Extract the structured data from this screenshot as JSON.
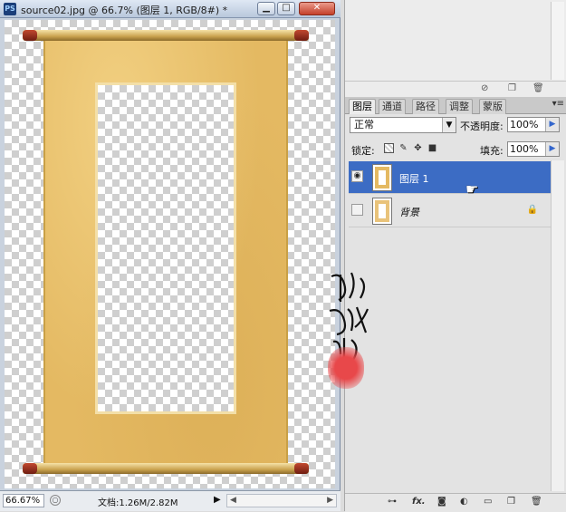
{
  "document_window": {
    "title": "source02.jpg @ 66.7% (图层 1, RGB/8#) *",
    "app_badge": "PS",
    "buttons": {
      "minimize": "▁",
      "maximize": "□",
      "close": "✕"
    },
    "status": {
      "zoom": "66.67%",
      "doc_info": "文档:1.26M/2.82M",
      "arrow": "▶"
    }
  },
  "layers_panel": {
    "tabs": [
      "图层",
      "通道",
      "路径",
      "调整",
      "蒙版"
    ],
    "active_tab": "图层",
    "menu_icon": "▾≡",
    "blend_mode": "正常",
    "opacity_label": "不透明度:",
    "opacity_value": "100%",
    "lock_label": "锁定:",
    "fill_label": "填充:",
    "fill_value": "100%",
    "layers": [
      {
        "name": "图层 1",
        "selected": true,
        "visible": true,
        "locked": false
      },
      {
        "name": "背景",
        "selected": false,
        "visible": false,
        "locked": true
      }
    ],
    "footer_icons": [
      "link-icon",
      "fx-icon",
      "mask-icon",
      "adjustment-icon",
      "group-icon",
      "new-layer-icon",
      "trash-icon"
    ],
    "fx_label": "fx."
  },
  "watermark": {
    "text": "他她我帮你"
  },
  "colors": {
    "selection": "#3c6cc4",
    "scroll_paper": "#e4b962",
    "seal": "#e8484a"
  }
}
